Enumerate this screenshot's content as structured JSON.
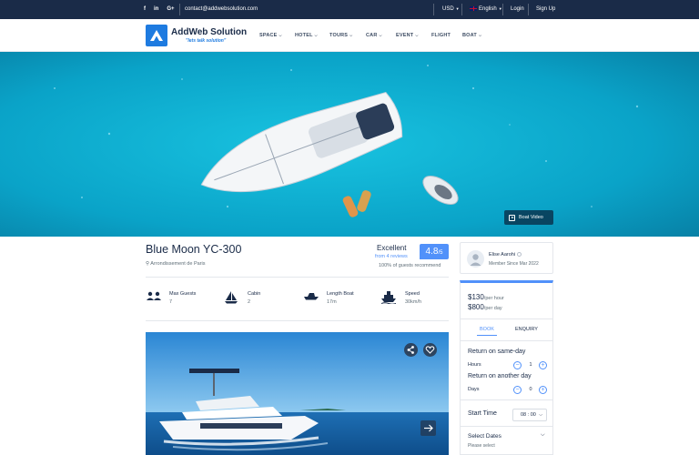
{
  "topbar": {
    "social": [
      "f",
      "in",
      "G+"
    ],
    "email": "contact@addwebsolution.com",
    "currency": "USD",
    "language": "English",
    "login": "Login",
    "signup": "Sign Up"
  },
  "header": {
    "logo_name": "AddWeb Solution",
    "logo_tagline": "\"lets talk solution\"",
    "nav": [
      {
        "label": "SPACE",
        "dropdown": true
      },
      {
        "label": "HOTEL",
        "dropdown": true
      },
      {
        "label": "TOURS",
        "dropdown": true
      },
      {
        "label": "CAR",
        "dropdown": true
      },
      {
        "label": "EVENT",
        "dropdown": true
      },
      {
        "label": "FLIGHT",
        "dropdown": false
      },
      {
        "label": "BOAT",
        "dropdown": true
      }
    ]
  },
  "hero": {
    "video_button": "Boat Video"
  },
  "listing": {
    "title": "Blue Moon YC-300",
    "location": "Arrondissement de Paris",
    "rating_label": "Excellent",
    "reviews": "from 4 reviews",
    "score": "4.8",
    "score_max": "/5",
    "recommend": "100% of guests recommend",
    "features": [
      {
        "label": "Max Guests",
        "value": "7",
        "icon": "guests-icon"
      },
      {
        "label": "Cabin",
        "value": "2",
        "icon": "sailboat-icon"
      },
      {
        "label": "Length Boat",
        "value": "17m",
        "icon": "speedboat-icon"
      },
      {
        "label": "Speed",
        "value": "30km/h",
        "icon": "ship-icon"
      }
    ]
  },
  "owner": {
    "name": "Elise Aarohi",
    "since": "Member Since Mar 2022"
  },
  "booking": {
    "price_hour": "$130",
    "price_hour_unit": "/per hour",
    "price_day": "$800",
    "price_day_unit": "/per day",
    "tab_book": "BOOK",
    "tab_enquiry": "ENQUIRY",
    "same_day_title": "Return on same-day",
    "hours_label": "Hours",
    "hours_value": "1",
    "another_day_title": "Return on another day",
    "days_label": "Days",
    "days_value": "0",
    "start_time_label": "Start Time",
    "start_time_value": "08 : 00",
    "dates_label": "Select Dates",
    "dates_placeholder": "Please select"
  },
  "colors": {
    "navy": "#1a2b48",
    "accent": "#5191fa",
    "logo_blue": "#1e7be0",
    "sea": "#0fa8c8"
  }
}
